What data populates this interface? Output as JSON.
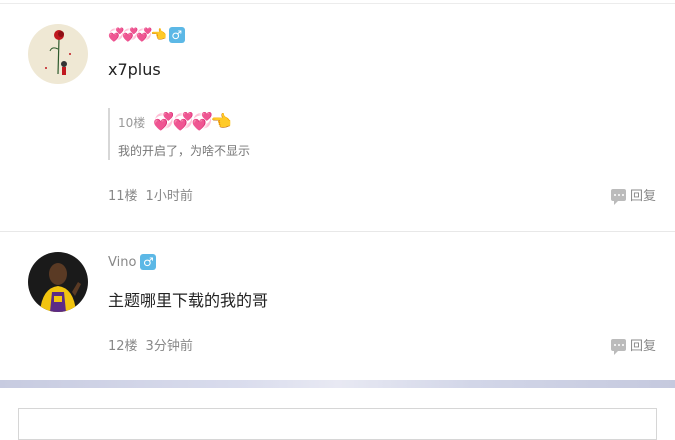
{
  "posts": [
    {
      "user": {
        "name_emoji": "💞💞💞👈",
        "gender_symbol": "♂"
      },
      "content": "x7plus",
      "quote": {
        "floor": "10楼",
        "author_emoji": "💞💞💞👈",
        "text": "我的开启了，为啥不显示"
      },
      "floor": "11楼",
      "time": "1小时前",
      "reply_label": "回复"
    },
    {
      "user": {
        "name": "Vino",
        "gender_symbol": "♂"
      },
      "content": "主题哪里下载的我的哥",
      "floor": "12楼",
      "time": "3分钟前",
      "reply_label": "回复"
    }
  ],
  "colors": {
    "gender_male": "#5cb8e6",
    "meta_text": "#888888"
  },
  "icons": {
    "reply": "comment-bubble-icon",
    "gender": "male-icon"
  }
}
